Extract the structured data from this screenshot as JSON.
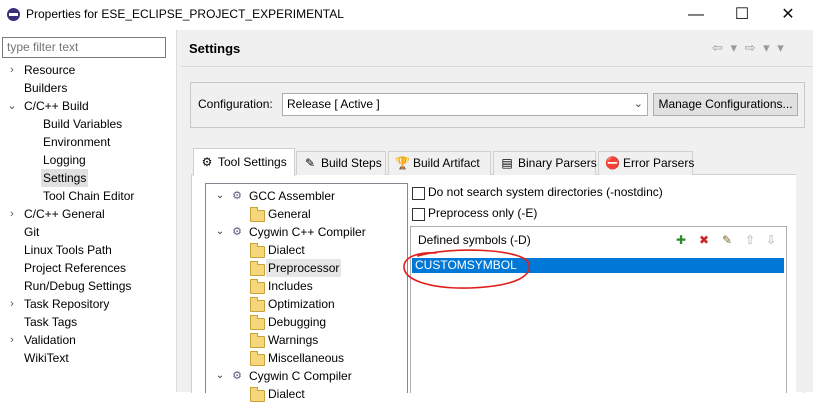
{
  "window": {
    "title": "Properties for ESE_ECLIPSE_PROJECT_EXPERIMENTAL",
    "minimize": "—",
    "maximize": "☐",
    "close": "✕"
  },
  "filter": {
    "placeholder": "type filter text"
  },
  "nav": [
    {
      "label": "Resource",
      "expander": "›",
      "level": 0
    },
    {
      "label": "Builders",
      "expander": "",
      "level": 0
    },
    {
      "label": "C/C++ Build",
      "expander": "⌄",
      "level": 0
    },
    {
      "label": "Build Variables",
      "expander": "",
      "level": 1
    },
    {
      "label": "Environment",
      "expander": "",
      "level": 1
    },
    {
      "label": "Logging",
      "expander": "",
      "level": 1
    },
    {
      "label": "Settings",
      "expander": "",
      "level": 1,
      "selected": true
    },
    {
      "label": "Tool Chain Editor",
      "expander": "",
      "level": 1
    },
    {
      "label": "C/C++ General",
      "expander": "›",
      "level": 0
    },
    {
      "label": "Git",
      "expander": "",
      "level": 0
    },
    {
      "label": "Linux Tools Path",
      "expander": "",
      "level": 0
    },
    {
      "label": "Project References",
      "expander": "",
      "level": 0
    },
    {
      "label": "Run/Debug Settings",
      "expander": "",
      "level": 0
    },
    {
      "label": "Task Repository",
      "expander": "›",
      "level": 0
    },
    {
      "label": "Task Tags",
      "expander": "",
      "level": 0
    },
    {
      "label": "Validation",
      "expander": "›",
      "level": 0
    },
    {
      "label": "WikiText",
      "expander": "",
      "level": 0
    }
  ],
  "page": {
    "title": "Settings",
    "history": "⇦ ▾ ⇨ ▾ ▾"
  },
  "configuration": {
    "label": "Configuration:",
    "value": "Release  [ Active ]",
    "manage_button": "Manage Configurations..."
  },
  "tabs": [
    {
      "label": "Tool Settings",
      "icon": "tool-settings-icon",
      "glyph": "⚙",
      "active": true
    },
    {
      "label": "Build Steps",
      "icon": "build-steps-icon",
      "glyph": "✎"
    },
    {
      "label": "Build Artifact",
      "icon": "build-artifact-icon",
      "glyph": "🏆"
    },
    {
      "label": "Binary Parsers",
      "icon": "binary-parsers-icon",
      "glyph": "▤"
    },
    {
      "label": "Error Parsers",
      "icon": "error-parsers-icon",
      "glyph": "⛔"
    }
  ],
  "tool_tree": [
    {
      "label": "GCC Assembler",
      "kind": "tool",
      "level": 0,
      "expander": "⌄"
    },
    {
      "label": "General",
      "kind": "folder",
      "level": 1
    },
    {
      "label": "Cygwin C++ Compiler",
      "kind": "tool",
      "level": 0,
      "expander": "⌄"
    },
    {
      "label": "Dialect",
      "kind": "folder",
      "level": 1
    },
    {
      "label": "Preprocessor",
      "kind": "folder",
      "level": 1,
      "selected": true
    },
    {
      "label": "Includes",
      "kind": "folder",
      "level": 1
    },
    {
      "label": "Optimization",
      "kind": "folder",
      "level": 1
    },
    {
      "label": "Debugging",
      "kind": "folder",
      "level": 1
    },
    {
      "label": "Warnings",
      "kind": "folder",
      "level": 1
    },
    {
      "label": "Miscellaneous",
      "kind": "folder",
      "level": 1
    },
    {
      "label": "Cygwin C Compiler",
      "kind": "tool",
      "level": 0,
      "expander": "⌄"
    },
    {
      "label": "Dialect",
      "kind": "folder",
      "level": 1
    }
  ],
  "options": {
    "nostdinc": "Do not search system directories (-nostdinc)",
    "preprocess_only": "Preprocess only (-E)"
  },
  "symbols": {
    "header": "Defined symbols (-D)",
    "items": [
      "CUSTOMSYMBOL"
    ],
    "toolbar": [
      "add-icon",
      "delete-icon",
      "edit-icon",
      "move-up-icon",
      "move-down-icon"
    ]
  },
  "colors": {
    "selection": "#0078d7",
    "annotation": "#e0201c"
  }
}
